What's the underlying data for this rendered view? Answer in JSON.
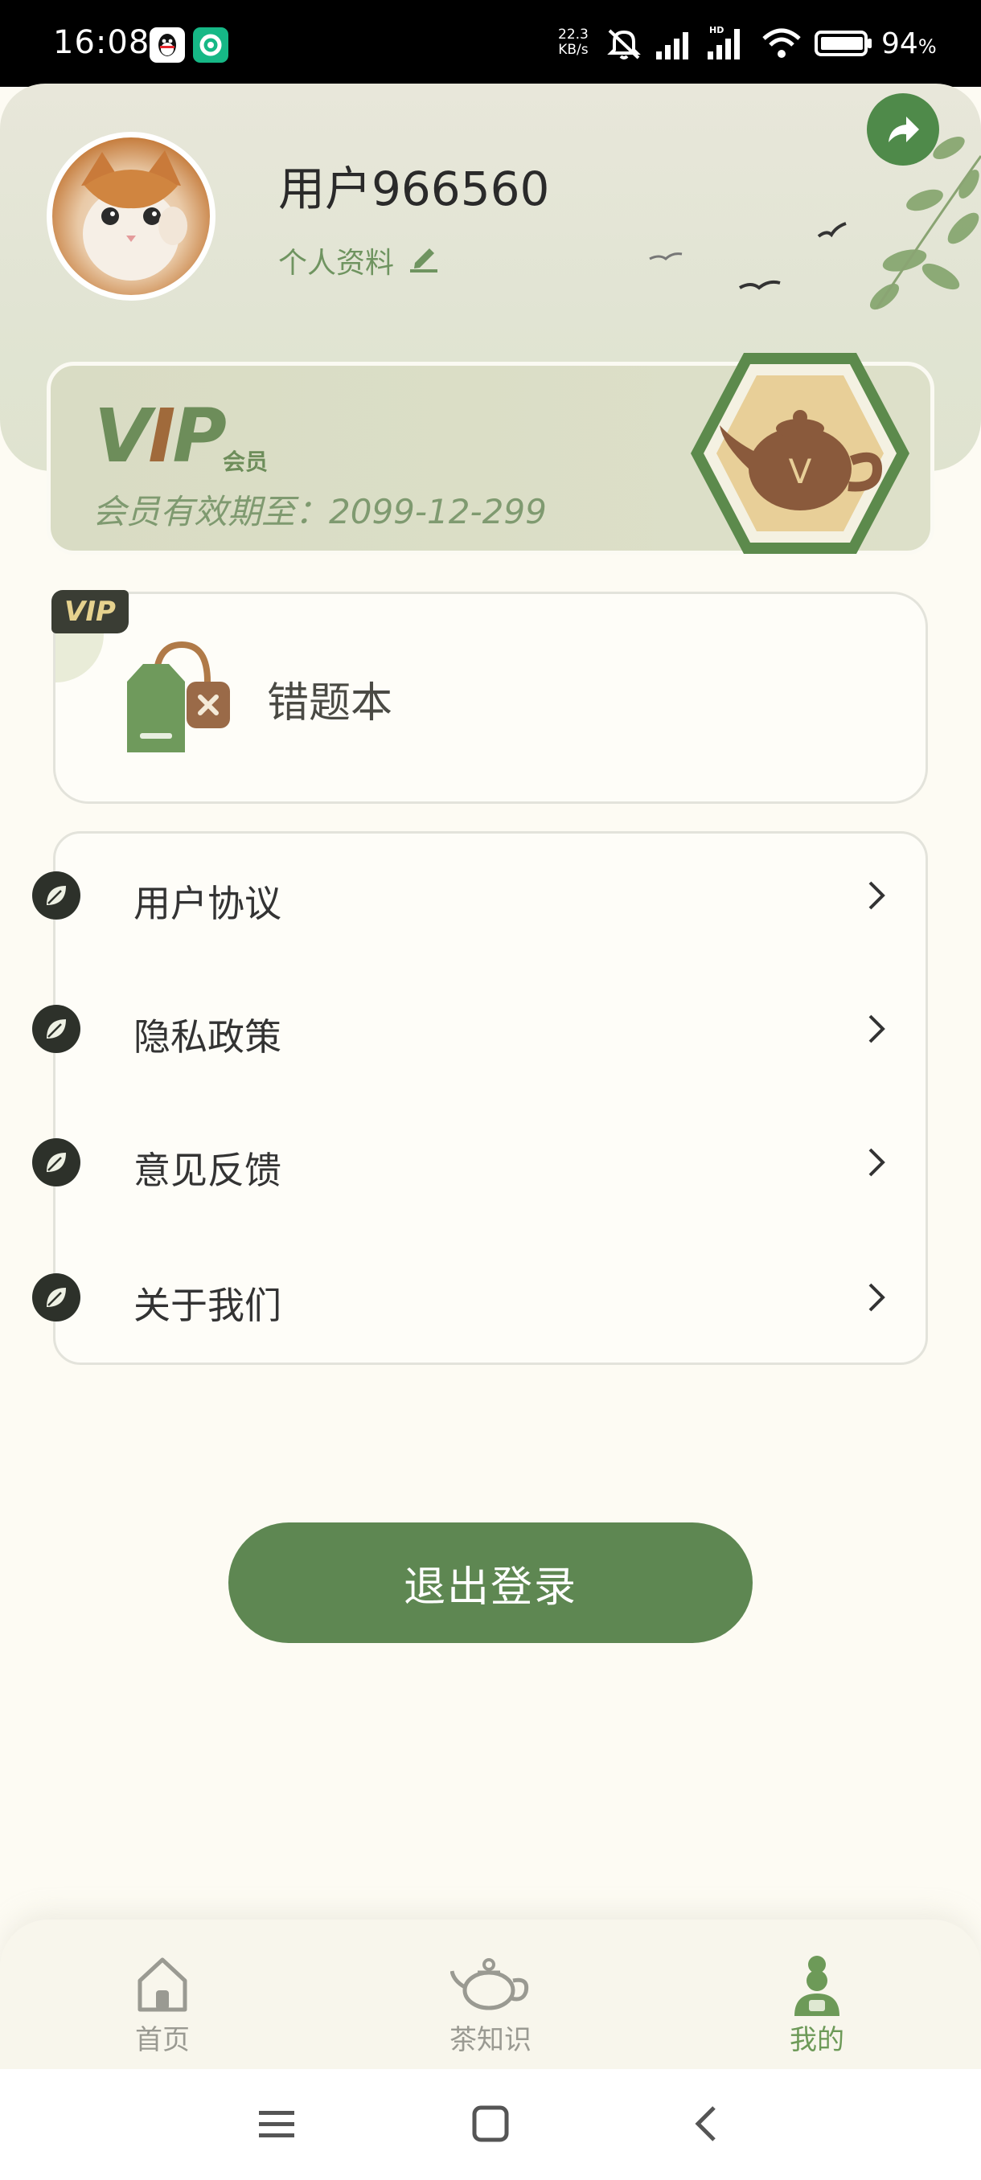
{
  "status_bar": {
    "time": "16:08",
    "net_speed_value": "22.3",
    "net_speed_unit": "KB/s",
    "hd_label": "HD",
    "battery_percent": "94",
    "battery_unit": "%",
    "notification_icons": [
      "qq-icon",
      "green-app-icon"
    ],
    "system_icons": [
      "mute-icon",
      "signal-icon",
      "signal-hd-icon",
      "wifi-icon",
      "battery-icon"
    ]
  },
  "profile": {
    "username": "用户966560",
    "edit_profile_label": "个人资料"
  },
  "vip": {
    "logo_text_v": "V",
    "logo_text_i": "I",
    "logo_text_p": "P",
    "member_label": "会员",
    "expiry_text": "会员有效期至：2099-12-299",
    "badge_letter": "V"
  },
  "mistakes": {
    "tag": "VIP",
    "label": "错题本"
  },
  "menu": {
    "items": [
      {
        "label": "用户协议"
      },
      {
        "label": "隐私政策"
      },
      {
        "label": "意见反馈"
      },
      {
        "label": "关于我们"
      }
    ]
  },
  "logout": {
    "label": "退出登录"
  },
  "tabbar": {
    "tabs": [
      {
        "label": "首页",
        "icon": "home-icon",
        "active": false
      },
      {
        "label": "茶知识",
        "icon": "teapot-icon",
        "active": false
      },
      {
        "label": "我的",
        "icon": "profile-person-icon",
        "active": true
      }
    ]
  },
  "colors": {
    "accent_green": "#5e8752",
    "header_bg": "#e1e4d3",
    "page_bg": "#fdfbf3"
  }
}
